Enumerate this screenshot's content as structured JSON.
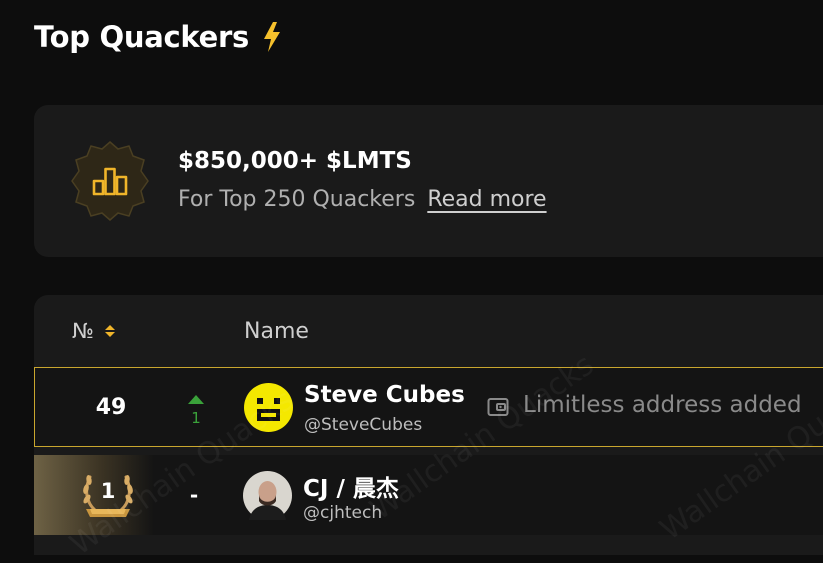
{
  "header": {
    "title": "Top Quackers",
    "title_icon": "lightning-bolt-icon",
    "accent_color": "#f5c02c"
  },
  "promo": {
    "amount": "$850,000+ $LMTS",
    "subtitle": "For Top 250 Quackers",
    "link_label": "Read more",
    "badge_icon": "leaderboard-badge-icon"
  },
  "table": {
    "col_rank": "№",
    "col_name": "Name",
    "rows": [
      {
        "rank": "49",
        "change_direction": "up",
        "change": "1",
        "name": "Steve Cubes",
        "handle": "@SteveCubes",
        "status": "Limitless address added",
        "status_icon": "wallet-icon",
        "highlight_color": "#c9a62e"
      },
      {
        "rank": "1",
        "change": "-",
        "name": "CJ / 晨杰",
        "handle": "@cjhtech"
      }
    ]
  },
  "watermark": "Wallchain Quacks"
}
